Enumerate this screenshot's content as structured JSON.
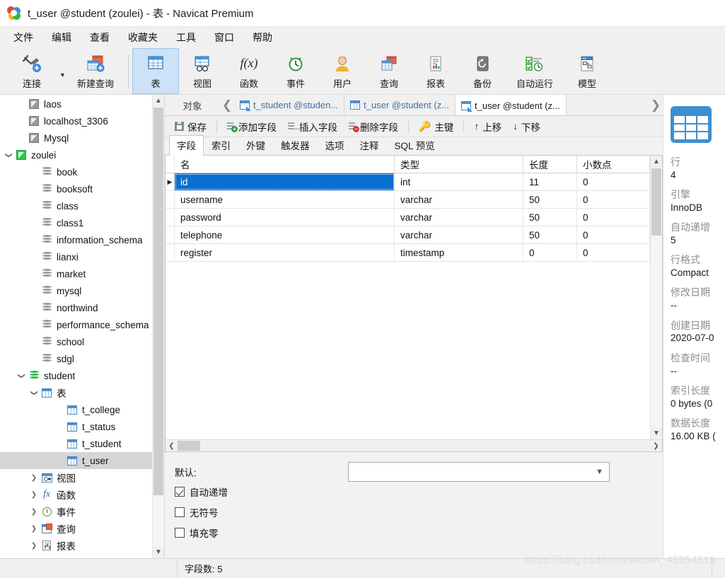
{
  "window": {
    "title": "t_user @student (zoulei) - 表 - Navicat Premium",
    "logo_icon": "navicat-logo-icon"
  },
  "menu": {
    "items": [
      {
        "label": "文件"
      },
      {
        "label": "编辑"
      },
      {
        "label": "查看"
      },
      {
        "label": "收藏夹"
      },
      {
        "label": "工具"
      },
      {
        "label": "窗口"
      },
      {
        "label": "帮助"
      }
    ]
  },
  "toolbar": {
    "items": [
      {
        "label": "连接",
        "icon": "connection-icon",
        "active": false,
        "has_caret": true
      },
      {
        "label": "新建查询",
        "icon": "new-query-icon",
        "active": false,
        "has_caret": false
      },
      {
        "label": "表",
        "icon": "table-icon",
        "active": true,
        "has_caret": false
      },
      {
        "label": "视图",
        "icon": "view-icon",
        "active": false,
        "has_caret": false
      },
      {
        "label": "函数",
        "icon": "function-icon",
        "active": false,
        "has_caret": false
      },
      {
        "label": "事件",
        "icon": "event-clock-icon",
        "active": false,
        "has_caret": false
      },
      {
        "label": "用户",
        "icon": "user-icon",
        "active": false,
        "has_caret": false
      },
      {
        "label": "查询",
        "icon": "query-icon",
        "active": false,
        "has_caret": false
      },
      {
        "label": "报表",
        "icon": "report-icon",
        "active": false,
        "has_caret": false
      },
      {
        "label": "备份",
        "icon": "backup-icon",
        "active": false,
        "has_caret": false
      },
      {
        "label": "自动运行",
        "icon": "automation-icon",
        "active": false,
        "has_caret": false
      },
      {
        "label": "模型",
        "icon": "model-icon",
        "active": false,
        "has_caret": false
      }
    ]
  },
  "sidebar": {
    "tree": [
      {
        "label": "laos",
        "icon": "connection-icon",
        "depth": 1,
        "twisty": "none",
        "connected": false,
        "selected": false
      },
      {
        "label": "localhost_3306",
        "icon": "connection-icon",
        "depth": 1,
        "twisty": "none",
        "connected": false,
        "selected": false
      },
      {
        "label": "Mysql",
        "icon": "connection-icon",
        "depth": 1,
        "twisty": "none",
        "connected": false,
        "selected": false
      },
      {
        "label": "zoulei",
        "icon": "connection-icon",
        "depth": 0,
        "twisty": "open",
        "connected": true,
        "selected": false
      },
      {
        "label": "book",
        "icon": "database-icon",
        "depth": 2,
        "twisty": "none",
        "connected": false,
        "selected": false
      },
      {
        "label": "booksoft",
        "icon": "database-icon",
        "depth": 2,
        "twisty": "none",
        "connected": false,
        "selected": false
      },
      {
        "label": "class",
        "icon": "database-icon",
        "depth": 2,
        "twisty": "none",
        "connected": false,
        "selected": false
      },
      {
        "label": "class1",
        "icon": "database-icon",
        "depth": 2,
        "twisty": "none",
        "connected": false,
        "selected": false
      },
      {
        "label": "information_schema",
        "icon": "database-icon",
        "depth": 2,
        "twisty": "none",
        "connected": false,
        "selected": false
      },
      {
        "label": "lianxi",
        "icon": "database-icon",
        "depth": 2,
        "twisty": "none",
        "connected": false,
        "selected": false
      },
      {
        "label": "market",
        "icon": "database-icon",
        "depth": 2,
        "twisty": "none",
        "connected": false,
        "selected": false
      },
      {
        "label": "mysql",
        "icon": "database-icon",
        "depth": 2,
        "twisty": "none",
        "connected": false,
        "selected": false
      },
      {
        "label": "northwind",
        "icon": "database-icon",
        "depth": 2,
        "twisty": "none",
        "connected": false,
        "selected": false
      },
      {
        "label": "performance_schema",
        "icon": "database-icon",
        "depth": 2,
        "twisty": "none",
        "connected": false,
        "selected": false
      },
      {
        "label": "school",
        "icon": "database-icon",
        "depth": 2,
        "twisty": "none",
        "connected": false,
        "selected": false
      },
      {
        "label": "sdgl",
        "icon": "database-icon",
        "depth": 2,
        "twisty": "none",
        "connected": false,
        "selected": false
      },
      {
        "label": "student",
        "icon": "database-icon",
        "depth": 1,
        "twisty": "open",
        "connected": true,
        "selected": false
      },
      {
        "label": "表",
        "icon": "table-icon",
        "depth": 2,
        "twisty": "open",
        "connected": false,
        "selected": false
      },
      {
        "label": "t_college",
        "icon": "table-icon",
        "depth": 4,
        "twisty": "none",
        "connected": false,
        "selected": false
      },
      {
        "label": "t_status",
        "icon": "table-icon",
        "depth": 4,
        "twisty": "none",
        "connected": false,
        "selected": false
      },
      {
        "label": "t_student",
        "icon": "table-icon",
        "depth": 4,
        "twisty": "none",
        "connected": false,
        "selected": false
      },
      {
        "label": "t_user",
        "icon": "table-icon",
        "depth": 4,
        "twisty": "none",
        "connected": false,
        "selected": true
      },
      {
        "label": "视图",
        "icon": "view-icon",
        "depth": 2,
        "twisty": "closed",
        "connected": false,
        "selected": false
      },
      {
        "label": "函数",
        "icon": "function-icon",
        "depth": 2,
        "twisty": "closed",
        "connected": false,
        "selected": false
      },
      {
        "label": "事件",
        "icon": "event-clock-icon",
        "depth": 2,
        "twisty": "closed",
        "connected": false,
        "selected": false
      },
      {
        "label": "查询",
        "icon": "query-icon",
        "depth": 2,
        "twisty": "closed",
        "connected": false,
        "selected": false
      },
      {
        "label": "报表",
        "icon": "report-icon",
        "depth": 2,
        "twisty": "closed",
        "connected": false,
        "selected": false
      }
    ],
    "scroll_up_icon": "chevron-up-icon",
    "scroll_down_icon": "chevron-down-icon"
  },
  "tabstrip": {
    "object_label": "对象",
    "prev_icon": "chevron-left-icon",
    "next_icon": "chevron-right-icon",
    "tabs": [
      {
        "label": "t_student @studen...",
        "icon": "table-design-icon",
        "active": false
      },
      {
        "label": "t_user @student (z...",
        "icon": "table-icon",
        "active": false
      },
      {
        "label": "t_user @student (z...",
        "icon": "table-design-icon",
        "active": true
      }
    ]
  },
  "cmdbar": {
    "buttons": [
      {
        "label": "保存",
        "icon": "save-icon"
      },
      {
        "label": "添加字段",
        "icon": "add-field-icon"
      },
      {
        "label": "插入字段",
        "icon": "insert-field-icon"
      },
      {
        "label": "删除字段",
        "icon": "delete-field-icon"
      },
      {
        "label": "主键",
        "icon": "primary-key-icon"
      },
      {
        "label": "上移",
        "icon": "move-up-icon"
      },
      {
        "label": "下移",
        "icon": "move-down-icon"
      }
    ]
  },
  "subtabs": {
    "items": [
      {
        "label": "字段",
        "active": true
      },
      {
        "label": "索引",
        "active": false
      },
      {
        "label": "外键",
        "active": false
      },
      {
        "label": "触发器",
        "active": false
      },
      {
        "label": "选项",
        "active": false
      },
      {
        "label": "注释",
        "active": false
      },
      {
        "label": "SQL 预览",
        "active": false
      }
    ]
  },
  "grid": {
    "columns": [
      "名",
      "类型",
      "长度",
      "小数点"
    ],
    "rows": [
      {
        "name": "id",
        "type": "int",
        "length": "11",
        "decimals": "0",
        "selected": true,
        "current": true
      },
      {
        "name": "username",
        "type": "varchar",
        "length": "50",
        "decimals": "0",
        "selected": false,
        "current": false
      },
      {
        "name": "password",
        "type": "varchar",
        "length": "50",
        "decimals": "0",
        "selected": false,
        "current": false
      },
      {
        "name": "telephone",
        "type": "varchar",
        "length": "50",
        "decimals": "0",
        "selected": false,
        "current": false
      },
      {
        "name": "register",
        "type": "timestamp",
        "length": "0",
        "decimals": "0",
        "selected": false,
        "current": false
      }
    ],
    "scroll_up_icon": "chevron-up-icon",
    "scroll_down_icon": "chevron-down-icon",
    "scroll_left_icon": "chevron-left-icon",
    "scroll_right_icon": "chevron-right-icon"
  },
  "props": {
    "default_label": "默认:",
    "default_value": "",
    "dropdown_icon": "chevron-down-icon",
    "checkboxes": [
      {
        "label": "自动递增",
        "checked": true
      },
      {
        "label": "无符号",
        "checked": false
      },
      {
        "label": "填充零",
        "checked": false
      }
    ]
  },
  "infopanel": {
    "icon": "table-info-icon",
    "fields": [
      {
        "key": "行",
        "value": "4"
      },
      {
        "key": "引擎",
        "value": "InnoDB"
      },
      {
        "key": "自动递增",
        "value": "5"
      },
      {
        "key": "行格式",
        "value": "Compact"
      },
      {
        "key": "修改日期",
        "value": "--"
      },
      {
        "key": "创建日期",
        "value": "2020-07-0"
      },
      {
        "key": "检查时间",
        "value": "--"
      },
      {
        "key": "索引长度",
        "value": "0 bytes (0"
      },
      {
        "key": "数据长度",
        "value": "16.00 KB ("
      }
    ]
  },
  "statusbar": {
    "field_count": "字段数: 5"
  },
  "watermark": "https://blog.csdn.net/weixin_45954319",
  "colors": {
    "accent": "#0a6fd0",
    "toolbar_active": "#cde2f7",
    "selected_row": "#0a6fd0",
    "tree_selected": "#d5d5d5",
    "chrome": "#f0f0f0"
  }
}
